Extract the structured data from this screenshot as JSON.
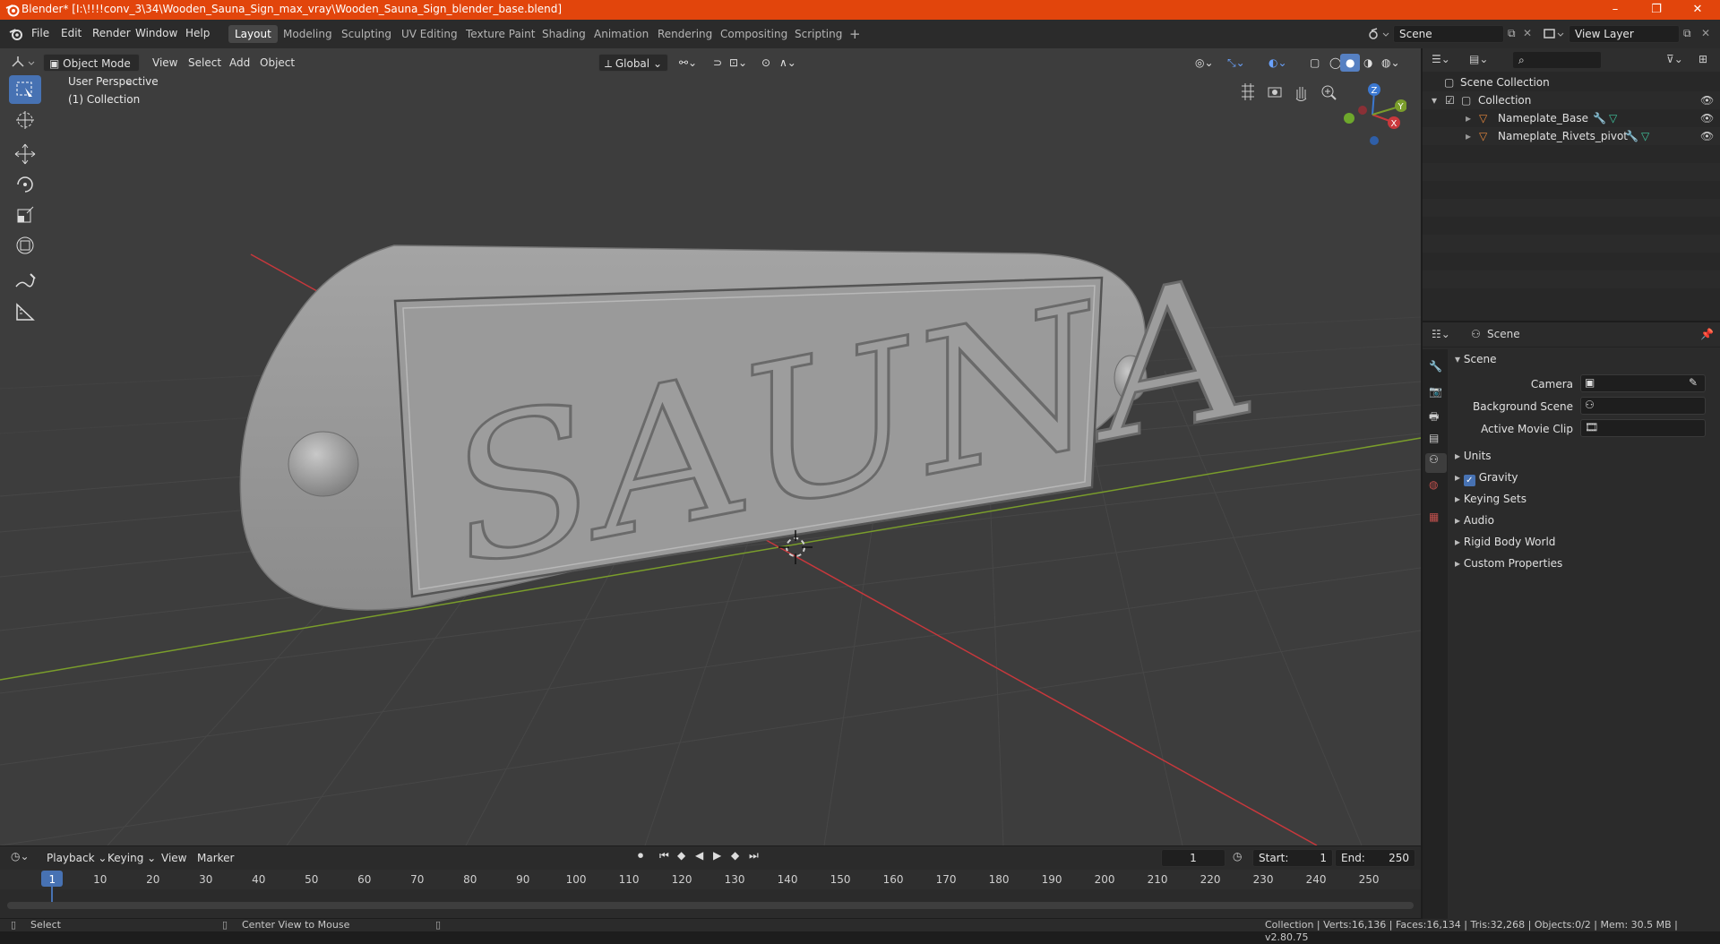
{
  "titlebar": {
    "title": "Blender* [I:\\!!!!conv_3\\34\\Wooden_Sauna_Sign_max_vray\\Wooden_Sauna_Sign_blender_base.blend]",
    "minimize": "–",
    "restore": "❐",
    "close": "✕"
  },
  "menu": [
    "File",
    "Edit",
    "Render",
    "Window",
    "Help"
  ],
  "workspaces": [
    "Layout",
    "Modeling",
    "Sculpting",
    "UV Editing",
    "Texture Paint",
    "Shading",
    "Animation",
    "Rendering",
    "Compositing",
    "Scripting"
  ],
  "workspace_add": "+",
  "scene_field": "Scene",
  "view_layer_field": "View Layer",
  "viewport": {
    "mode": "Object Mode",
    "menus": [
      "View",
      "Select",
      "Add",
      "Object"
    ],
    "orientation": "Global",
    "overlay_text_1": "User Perspective",
    "overlay_text_2": "(1) Collection",
    "sign_text": "SAUNA",
    "gizmo_x": "X",
    "gizmo_y": "Y",
    "gizmo_z": "Z"
  },
  "outliner": {
    "search_placeholder": "",
    "scene_collection": "Scene Collection",
    "collection": "Collection",
    "objects": [
      "Nameplate_Base",
      "Nameplate_Rivets_pivot"
    ]
  },
  "properties": {
    "header": "Scene",
    "panel_title": "Scene",
    "camera_label": "Camera",
    "background_scene_label": "Background Scene",
    "active_movie_clip_label": "Active Movie Clip",
    "subpanels": [
      "Units",
      "Gravity",
      "Keying Sets",
      "Audio",
      "Rigid Body World",
      "Custom Properties"
    ],
    "gravity_checked": true
  },
  "timeline": {
    "menus": [
      "Playback",
      "Keying",
      "View",
      "Marker"
    ],
    "current_frame": "1",
    "start_label": "Start:",
    "start_value": "1",
    "end_label": "End:",
    "end_value": "250",
    "ruler": [
      "1",
      "10",
      "20",
      "30",
      "40",
      "50",
      "60",
      "70",
      "80",
      "90",
      "100",
      "110",
      "120",
      "130",
      "140",
      "150",
      "160",
      "170",
      "180",
      "190",
      "200",
      "210",
      "220",
      "230",
      "240",
      "250"
    ]
  },
  "statusbar": {
    "select": "Select",
    "center_view": "Center View to Mouse",
    "stats": "Collection | Verts:16,136 | Faces:16,134 | Tris:32,268 | Objects:0/2 | Mem: 30.5 MB | v2.80.75"
  },
  "colors": {
    "titlebar": "#e2450c",
    "accent": "#4772b3",
    "viewport_bg": "#3d3d3d",
    "x_axis": "#c8383c",
    "y_axis": "#7a9d2b",
    "z_axis": "#3b78d1"
  }
}
